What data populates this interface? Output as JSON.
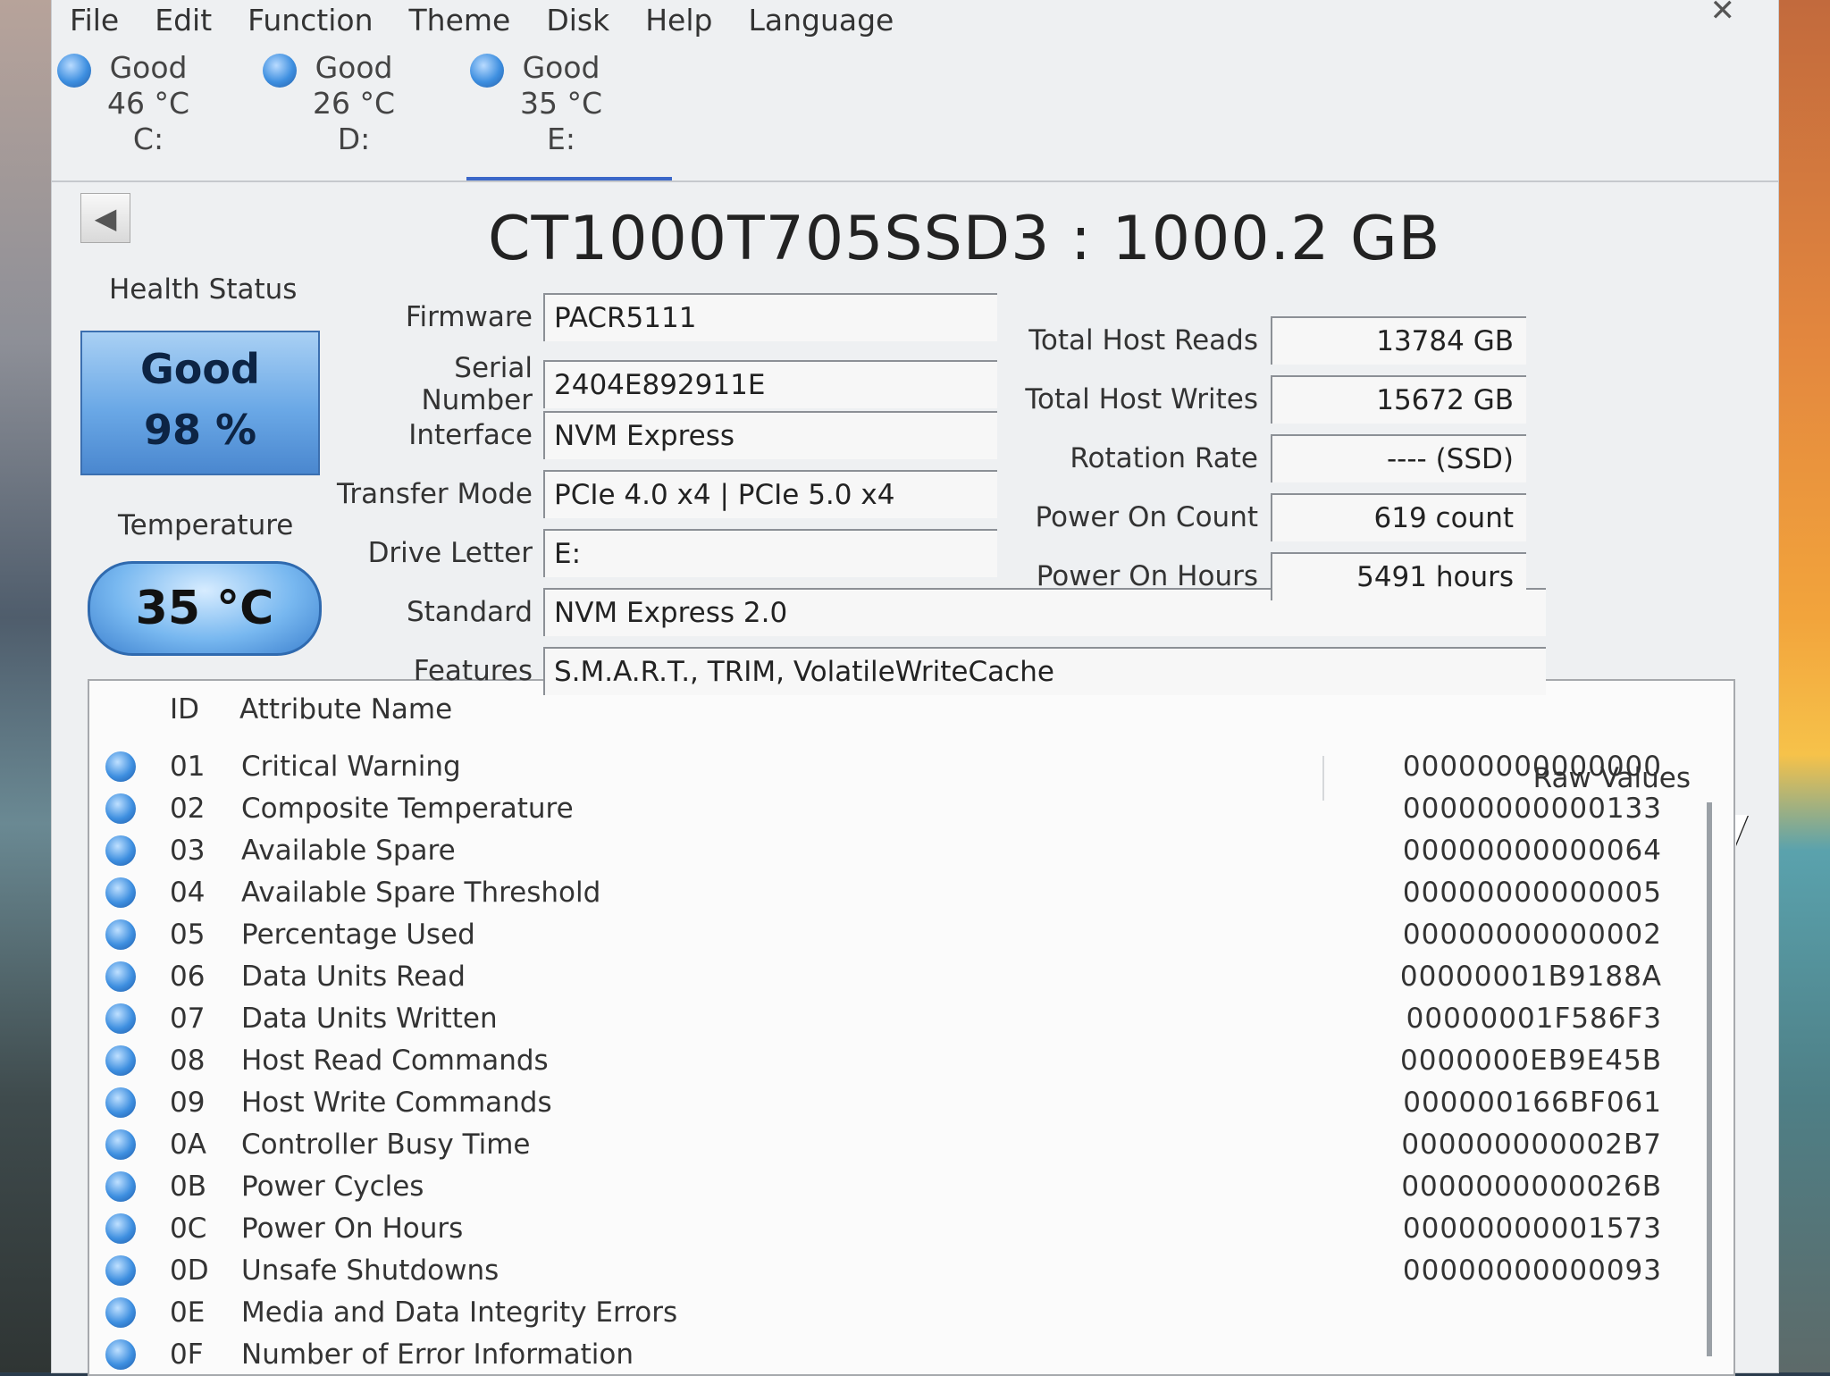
{
  "menu": [
    "File",
    "Edit",
    "Function",
    "Theme",
    "Disk",
    "Help",
    "Language"
  ],
  "drives": [
    {
      "status": "Good",
      "temp": "46 °C",
      "letter": "C:"
    },
    {
      "status": "Good",
      "temp": "26 °C",
      "letter": "D:"
    },
    {
      "status": "Good",
      "temp": "35 °C",
      "letter": "E:"
    }
  ],
  "model": "CT1000T705SSD3 : 1000.2 GB",
  "health": {
    "label": "Health Status",
    "status": "Good",
    "percent": "98 %"
  },
  "temperature": {
    "label": "Temperature",
    "value": "35 °C"
  },
  "info": {
    "firmware": {
      "label": "Firmware",
      "value": "PACR5111"
    },
    "serial": {
      "label": "Serial Number",
      "value": "2404E892911E"
    },
    "interface": {
      "label": "Interface",
      "value": "NVM Express"
    },
    "transfer": {
      "label": "Transfer Mode",
      "value": "PCIe 4.0 x4 | PCIe 5.0 x4"
    },
    "drive_letter": {
      "label": "Drive Letter",
      "value": "E:"
    },
    "standard": {
      "label": "Standard",
      "value": "NVM Express 2.0"
    },
    "features": {
      "label": "Features",
      "value": "S.M.A.R.T., TRIM, VolatileWriteCache"
    }
  },
  "stats": {
    "host_reads": {
      "label": "Total Host Reads",
      "value": "13784 GB"
    },
    "host_writes": {
      "label": "Total Host Writes",
      "value": "15672 GB"
    },
    "rotation": {
      "label": "Rotation Rate",
      "value": "---- (SSD)"
    },
    "power_count": {
      "label": "Power On Count",
      "value": "619 count"
    },
    "power_hours": {
      "label": "Power On Hours",
      "value": "5491 hours"
    }
  },
  "table": {
    "headers": {
      "id": "ID",
      "name": "Attribute Name",
      "raw": "Raw Values"
    },
    "rows": [
      {
        "id": "01",
        "name": "Critical Warning",
        "raw": "00000000000000"
      },
      {
        "id": "02",
        "name": "Composite Temperature",
        "raw": "00000000000133"
      },
      {
        "id": "03",
        "name": "Available Spare",
        "raw": "00000000000064"
      },
      {
        "id": "04",
        "name": "Available Spare Threshold",
        "raw": "00000000000005"
      },
      {
        "id": "05",
        "name": "Percentage Used",
        "raw": "00000000000002"
      },
      {
        "id": "06",
        "name": "Data Units Read",
        "raw": "00000001B9188A"
      },
      {
        "id": "07",
        "name": "Data Units Written",
        "raw": "00000001F586F3"
      },
      {
        "id": "08",
        "name": "Host Read Commands",
        "raw": "0000000EB9E45B"
      },
      {
        "id": "09",
        "name": "Host Write Commands",
        "raw": "000000166BF061"
      },
      {
        "id": "0A",
        "name": "Controller Busy Time",
        "raw": "000000000002B7"
      },
      {
        "id": "0B",
        "name": "Power Cycles",
        "raw": "0000000000026B"
      },
      {
        "id": "0C",
        "name": "Power On Hours",
        "raw": "00000000001573"
      },
      {
        "id": "0D",
        "name": "Unsafe Shutdowns",
        "raw": "00000000000093"
      },
      {
        "id": "0E",
        "name": "Media and Data Integrity Errors",
        "raw": ""
      },
      {
        "id": "0F",
        "name": "Number of Error Information",
        "raw": ""
      }
    ]
  }
}
